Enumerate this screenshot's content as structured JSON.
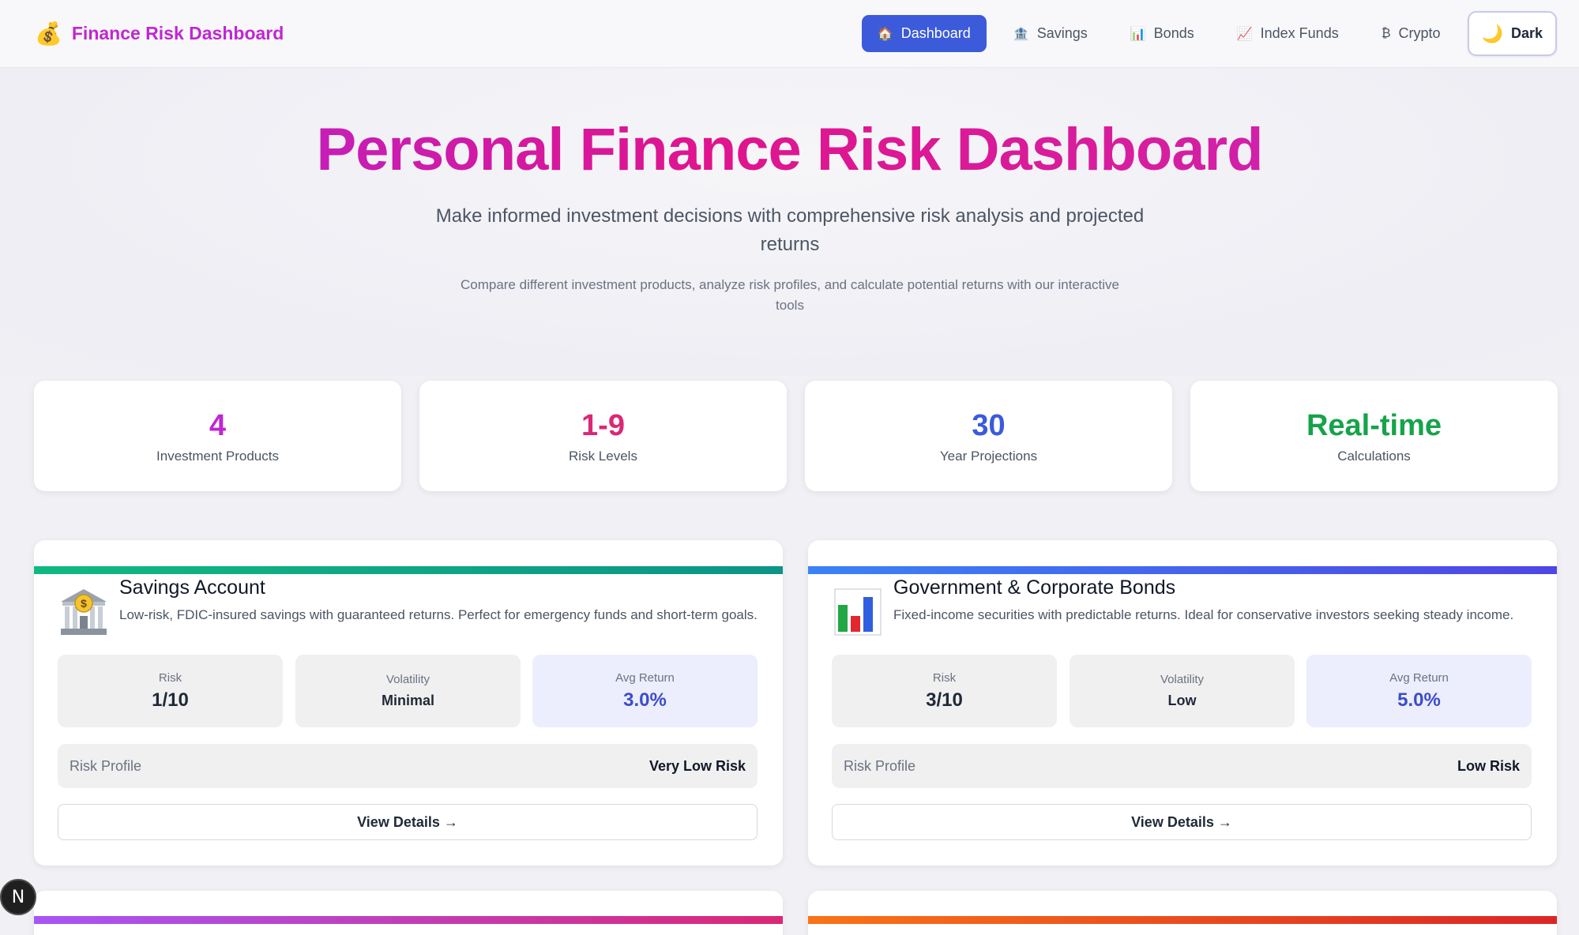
{
  "navbar": {
    "brand_icon": "money-bag-icon",
    "brand_title": "Finance Risk Dashboard",
    "items": [
      {
        "label": "Dashboard",
        "icon": "house-icon",
        "glyph": "🏠",
        "active": true
      },
      {
        "label": "Savings",
        "icon": "bank-icon",
        "glyph": "🏦",
        "active": false
      },
      {
        "label": "Bonds",
        "icon": "bar-chart-icon",
        "glyph": "📊",
        "active": false
      },
      {
        "label": "Index Funds",
        "icon": "line-chart-icon",
        "glyph": "📈",
        "active": false
      },
      {
        "label": "Crypto",
        "icon": "bitcoin-icon",
        "glyph": "₿",
        "active": false
      }
    ],
    "theme_toggle": {
      "label": "Dark",
      "icon": "moon-icon"
    }
  },
  "hero": {
    "title": "Personal Finance Risk Dashboard",
    "subtitle": "Make informed investment decisions with comprehensive risk analysis and projected returns",
    "description": "Compare different investment products, analyze risk profiles, and calculate potential returns with our interactive tools"
  },
  "stats": [
    {
      "value": "4",
      "label": "Investment Products",
      "color": "#c026d3"
    },
    {
      "value": "1-9",
      "label": "Risk Levels",
      "color": "#db2777"
    },
    {
      "value": "30",
      "label": "Year Projections",
      "color": "#3b5bdb"
    },
    {
      "value": "Real-time",
      "label": "Calculations",
      "color": "#16a34a"
    }
  ],
  "products": [
    {
      "title": "Savings Account",
      "icon": "bank-building-icon",
      "accent": [
        "#10b981",
        "#0d9488"
      ],
      "description": "Low-risk, FDIC-insured savings with guaranteed returns. Perfect for emergency funds and short-term goals.",
      "risk_label": "Risk",
      "risk_value": "1/10",
      "volatility_label": "Volatility",
      "volatility_value": "Minimal",
      "return_label": "Avg Return",
      "return_value": "3.0%",
      "profile_label": "Risk Profile",
      "profile_value": "Very Low Risk",
      "button": "View Details →"
    },
    {
      "title": "Government & Corporate Bonds",
      "icon": "bar-chart-icon",
      "accent": [
        "#3b82f6",
        "#4f46e5"
      ],
      "description": "Fixed-income securities with predictable returns. Ideal for conservative investors seeking steady income.",
      "risk_label": "Risk",
      "risk_value": "3/10",
      "volatility_label": "Volatility",
      "volatility_value": "Low",
      "return_label": "Avg Return",
      "return_value": "5.0%",
      "profile_label": "Risk Profile",
      "profile_value": "Low Risk",
      "button": "View Details →"
    }
  ],
  "partial_cards": [
    {
      "accent": [
        "#a855f7",
        "#db2777"
      ]
    },
    {
      "accent": [
        "#f97316",
        "#dc2626"
      ]
    }
  ],
  "floating_badge": "N"
}
